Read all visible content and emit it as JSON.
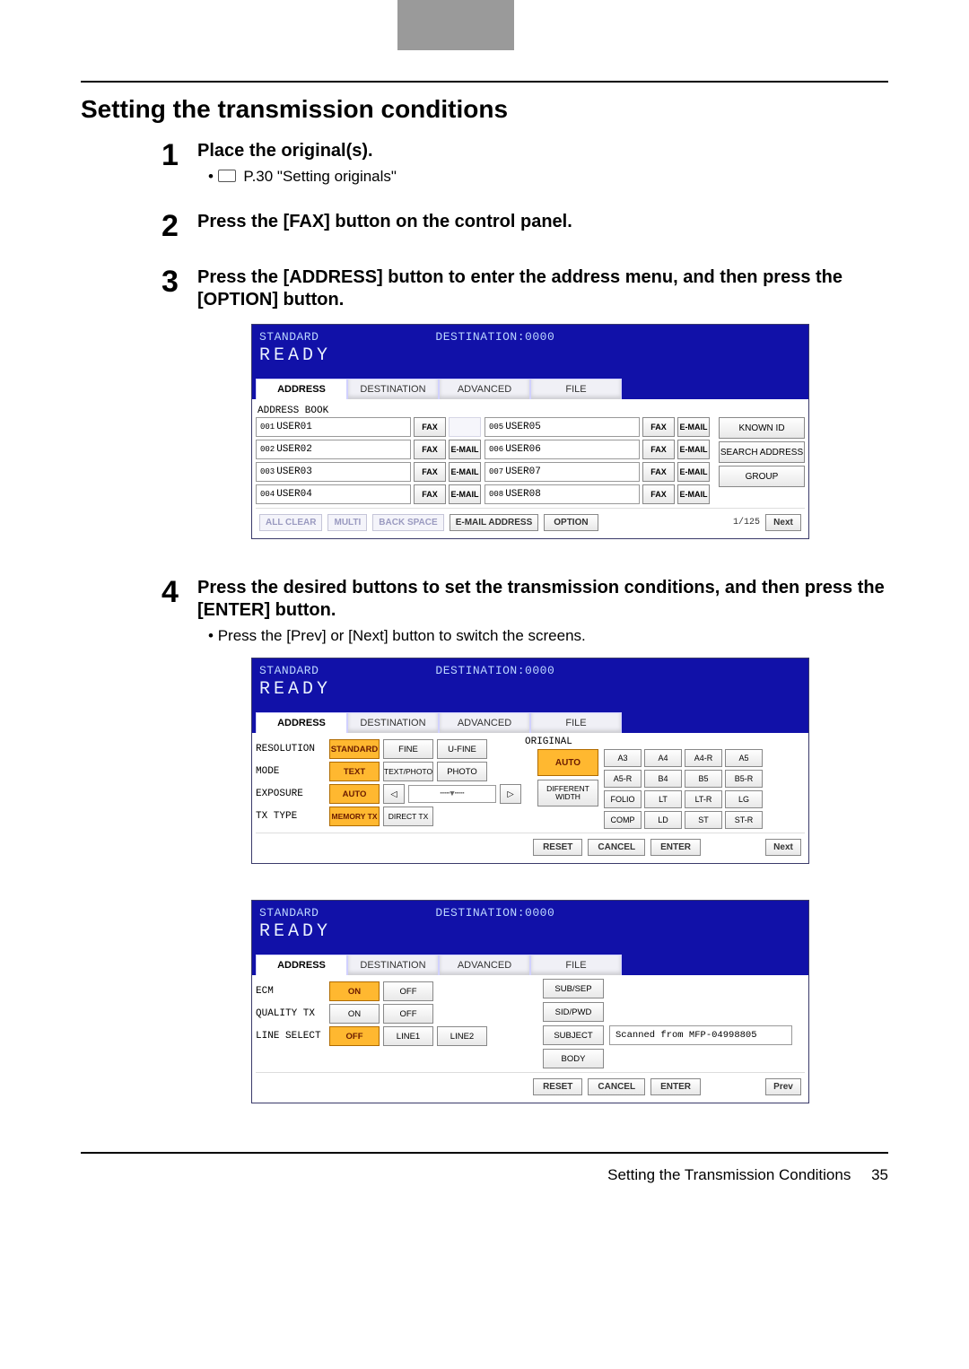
{
  "page": {
    "title": "Setting the transmission conditions",
    "footer_label": "Setting the Transmission Conditions",
    "page_number": "35"
  },
  "steps": [
    {
      "num": "1",
      "title": "Place the original(s).",
      "bullet_icon": true,
      "bullet": "P.30 \"Setting originals\""
    },
    {
      "num": "2",
      "title": "Press the [FAX] button on the control panel."
    },
    {
      "num": "3",
      "title": "Press the [ADDRESS] button to enter the address menu, and then press the [OPTION] button."
    },
    {
      "num": "4",
      "title": "Press the desired buttons to set the transmission conditions, and then press the [ENTER] button.",
      "bullet": "Press the [Prev] or [Next] button to switch the screens."
    }
  ],
  "panel_common": {
    "mode": "STANDARD",
    "destination": "DESTINATION:0000",
    "status": "READY",
    "tabs": {
      "address": "ADDRESS",
      "destination_tab": "DESTINATION",
      "advanced": "ADVANCED",
      "file": "FILE"
    }
  },
  "screen1": {
    "sub_label": "ADDRESS BOOK",
    "entries_left": [
      {
        "num": "001",
        "name": "USER01",
        "fax": "FAX",
        "email": ""
      },
      {
        "num": "002",
        "name": "USER02",
        "fax": "FAX",
        "email": "E-MAIL"
      },
      {
        "num": "003",
        "name": "USER03",
        "fax": "FAX",
        "email": "E-MAIL"
      },
      {
        "num": "004",
        "name": "USER04",
        "fax": "FAX",
        "email": "E-MAIL"
      }
    ],
    "entries_right": [
      {
        "num": "005",
        "name": "USER05",
        "fax": "FAX",
        "email": "E-MAIL"
      },
      {
        "num": "006",
        "name": "USER06",
        "fax": "FAX",
        "email": "E-MAIL"
      },
      {
        "num": "007",
        "name": "USER07",
        "fax": "FAX",
        "email": "E-MAIL"
      },
      {
        "num": "008",
        "name": "USER08",
        "fax": "FAX",
        "email": "E-MAIL"
      }
    ],
    "side": {
      "known": "KNOWN ID",
      "search": "SEARCH ADDRESS",
      "group": "GROUP"
    },
    "footer": {
      "all_clear": "ALL CLEAR",
      "multi": "MULTI",
      "backspace": "BACK SPACE",
      "email_addr": "E-MAIL ADDRESS",
      "option": "OPTION",
      "page": "1/125",
      "next": "Next"
    }
  },
  "screen2": {
    "labels": {
      "resolution": "RESOLUTION",
      "mode": "MODE",
      "exposure": "EXPOSURE",
      "tx_type": "TX TYPE",
      "original": "ORIGINAL"
    },
    "resolution": {
      "standard": "STANDARD",
      "fine": "FINE",
      "ufine": "U-FINE"
    },
    "mode": {
      "text": "TEXT",
      "text_photo": "TEXT/PHOTO",
      "photo": "PHOTO"
    },
    "exposure": {
      "auto": "AUTO",
      "left": "◁",
      "right": "▷",
      "track": "┅┅▼┅┅"
    },
    "tx_type": {
      "memory": "MEMORY TX",
      "direct": "DIRECT TX"
    },
    "original": {
      "auto": "AUTO",
      "diff_width": "DIFFERENT\nWIDTH",
      "sizes": [
        "A3",
        "A4",
        "A4-R",
        "A5",
        "A5-R",
        "B4",
        "B5",
        "B5-R",
        "FOLIO",
        "LT",
        "LT-R",
        "LG",
        "COMP",
        "LD",
        "ST",
        "ST-R"
      ]
    },
    "footer": {
      "reset": "RESET",
      "cancel": "CANCEL",
      "enter": "ENTER",
      "next": "Next"
    }
  },
  "screen3": {
    "labels": {
      "ecm": "ECM",
      "quality": "QUALITY TX",
      "line": "LINE SELECT"
    },
    "onoff": {
      "on": "ON",
      "off": "OFF"
    },
    "line": {
      "off": "OFF",
      "line1": "LINE1",
      "line2": "LINE2"
    },
    "right_fields": {
      "subsep": "SUB/SEP",
      "sidpwd": "SID/PWD",
      "subject": "SUBJECT",
      "subject_value": "Scanned from MFP-04998805",
      "body": "BODY"
    },
    "footer": {
      "reset": "RESET",
      "cancel": "CANCEL",
      "enter": "ENTER",
      "prev": "Prev"
    }
  }
}
